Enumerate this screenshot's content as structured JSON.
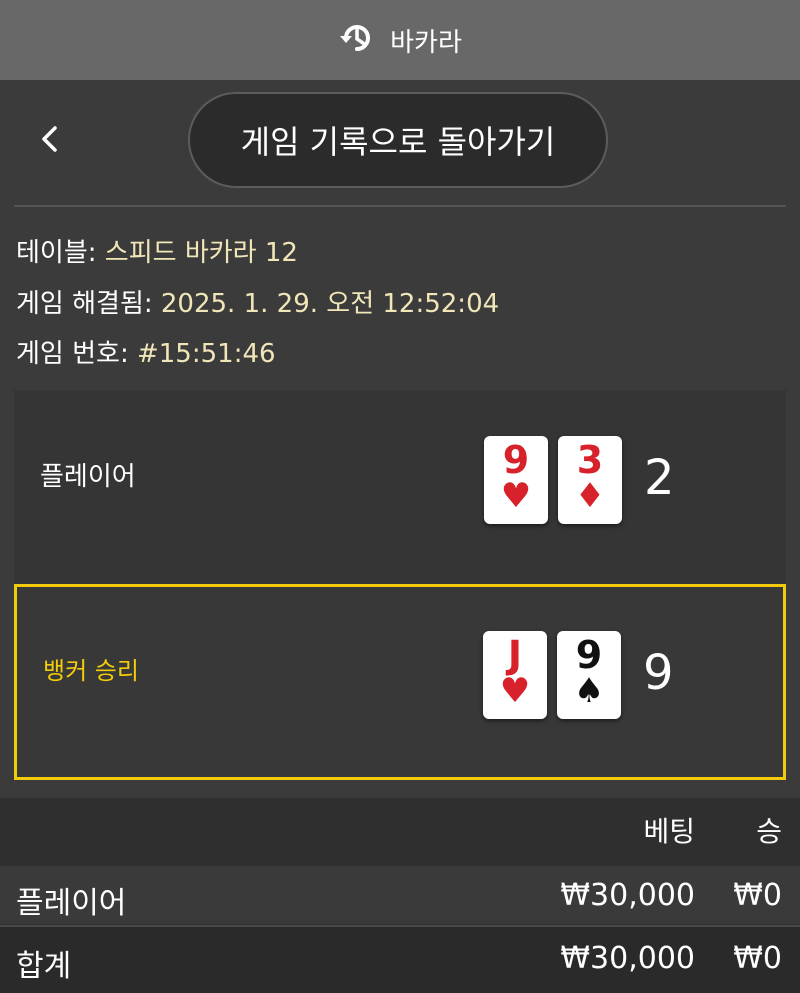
{
  "header": {
    "title": "바카라",
    "icon": "history-icon"
  },
  "nav": {
    "back_icon": "chevron-left-icon",
    "return_button": "게임 기록으로 돌아가기"
  },
  "info": {
    "table_label": "테이블:",
    "table_value": "스피드 바카라 12",
    "resolved_label": "게임 해결됨:",
    "resolved_value": "2025. 1. 29. 오전 12:52:04",
    "number_label": "게임 번호:",
    "number_value": "#15:51:46"
  },
  "hands": {
    "player": {
      "label": "플레이어",
      "score": "2",
      "cards": [
        {
          "rank": "9",
          "suit": "♥",
          "color": "#d8222b"
        },
        {
          "rank": "3",
          "suit": "♦",
          "color": "#d8222b"
        }
      ]
    },
    "banker": {
      "label": "뱅커 승리",
      "score": "9",
      "highlight_color": "#f2cc0a",
      "cards": [
        {
          "rank": "J",
          "suit": "♥",
          "color": "#d8222b"
        },
        {
          "rank": "9",
          "suit": "♠",
          "color": "#111111"
        }
      ]
    }
  },
  "bets": {
    "col_bet": "베팅",
    "col_win": "승",
    "rows": [
      {
        "label": "플레이어",
        "bet": "₩30,000",
        "win": "₩0"
      }
    ],
    "total": {
      "label": "합계",
      "bet": "₩30,000",
      "win": "₩0"
    }
  }
}
